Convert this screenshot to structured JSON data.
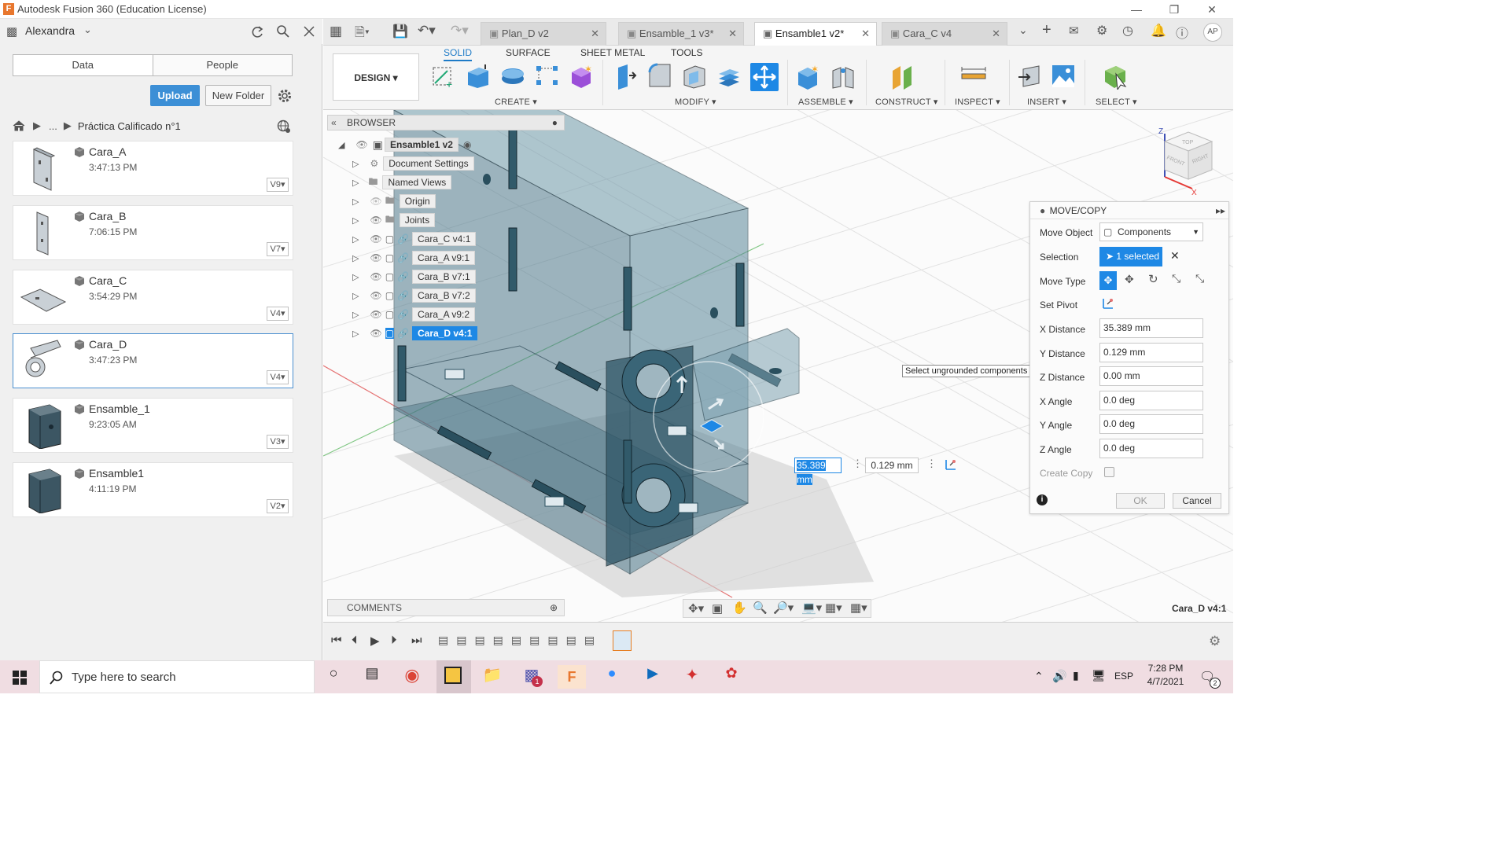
{
  "window": {
    "title": "Autodesk Fusion 360 (Education License)",
    "app_icon": "F"
  },
  "left_panel": {
    "user": "Alexandra",
    "tabs": [
      "Data",
      "People"
    ],
    "upload_label": "Upload",
    "new_folder_label": "New Folder",
    "breadcrumb_ellipsis": "...",
    "breadcrumb": "Práctica Calificado n°1",
    "files": [
      {
        "name": "Cara_A",
        "time": "3:47:13 PM",
        "version": "V9"
      },
      {
        "name": "Cara_B",
        "time": "7:06:15 PM",
        "version": "V7"
      },
      {
        "name": "Cara_C",
        "time": "3:54:29 PM",
        "version": "V4"
      },
      {
        "name": "Cara_D",
        "time": "3:47:23 PM",
        "version": "V4"
      },
      {
        "name": "Ensamble_1",
        "time": "9:23:05 AM",
        "version": "V3"
      },
      {
        "name": "Ensamble1",
        "time": "4:11:19 PM",
        "version": "V2"
      }
    ]
  },
  "doc_tabs": [
    {
      "label": "Plan_D v2"
    },
    {
      "label": "Ensamble_1 v3*"
    },
    {
      "label": "Ensamble1 v2*"
    },
    {
      "label": "Cara_C v4"
    }
  ],
  "user_initials": "AP",
  "ribbon": {
    "workspace": "DESIGN",
    "tabs": [
      "SOLID",
      "SURFACE",
      "SHEET METAL",
      "TOOLS"
    ],
    "groups": [
      "CREATE",
      "MODIFY",
      "ASSEMBLE",
      "CONSTRUCT",
      "INSPECT",
      "INSERT",
      "SELECT"
    ]
  },
  "browser": {
    "title": "BROWSER",
    "root": "Ensamble1 v2",
    "items": [
      {
        "label": "Document Settings"
      },
      {
        "label": "Named Views"
      },
      {
        "label": "Origin"
      },
      {
        "label": "Joints"
      },
      {
        "label": "Cara_C v4:1"
      },
      {
        "label": "Cara_A v9:1"
      },
      {
        "label": "Cara_B v7:1"
      },
      {
        "label": "Cara_B v7:2"
      },
      {
        "label": "Cara_A v9:2"
      },
      {
        "label": "Cara_D v4:1"
      }
    ]
  },
  "viewcube": {
    "top": "TOP",
    "front": "FRONT",
    "right": "RIGHT",
    "axis_z": "Z",
    "axis_x": "X"
  },
  "dialog": {
    "title": "MOVE/COPY",
    "move_object_label": "Move Object",
    "move_object_value": "Components",
    "selection_label": "Selection",
    "selection_value": "1 selected",
    "move_type_label": "Move Type",
    "set_pivot_label": "Set Pivot",
    "x_distance_label": "X Distance",
    "x_distance": "35.389 mm",
    "y_distance_label": "Y Distance",
    "y_distance": "0.129 mm",
    "z_distance_label": "Z Distance",
    "z_distance": "0.00 mm",
    "x_angle_label": "X Angle",
    "x_angle": "0.0 deg",
    "y_angle_label": "Y Angle",
    "y_angle": "0.0 deg",
    "z_angle_label": "Z Angle",
    "z_angle": "0.0 deg",
    "create_copy_label": "Create Copy",
    "ok_label": "OK",
    "cancel_label": "Cancel"
  },
  "tooltip": "Select ungrounded components to move",
  "inline_inputs": {
    "x": "35.389 mm",
    "y": "0.129 mm"
  },
  "comments_label": "COMMENTS",
  "status_selection": "Cara_D v4:1",
  "taskbar": {
    "search_placeholder": "Type here to search",
    "lang": "ESP",
    "time": "7:28 PM",
    "date": "4/7/2021",
    "notif_count": "2"
  }
}
